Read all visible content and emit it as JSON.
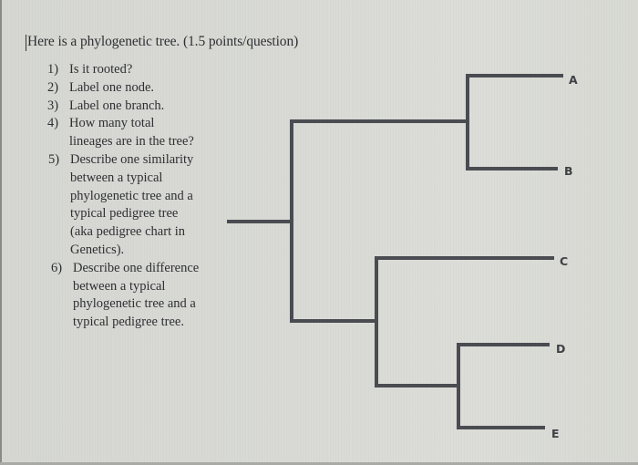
{
  "document": {
    "title": "Here is a phylogenetic tree. (1.5 points/question)",
    "questions": [
      {
        "number": "1)",
        "lines": [
          "Is it rooted?"
        ]
      },
      {
        "number": "2)",
        "lines": [
          "Label one node."
        ]
      },
      {
        "number": "3)",
        "lines": [
          "Label one branch."
        ]
      },
      {
        "number": "4)",
        "lines": [
          "How many total",
          "lineages are in the tree?"
        ]
      },
      {
        "number": "5)",
        "lines": [
          "Describe one similarity",
          "between a typical",
          "phylogenetic tree and a",
          "typical pedigree tree",
          "(aka pedigree chart in",
          "Genetics)."
        ]
      },
      {
        "number": "6)",
        "lines": [
          "Describe one difference",
          "between a typical",
          "phylogenetic tree and a",
          "typical pedigree tree."
        ]
      }
    ]
  },
  "tree": {
    "rooted": true,
    "branch_color": "#4a4c52",
    "label_color": "#3f4046",
    "topology": "((A,B),(C,(D,E)))",
    "tips": [
      "A",
      "B",
      "C",
      "D",
      "E"
    ]
  }
}
